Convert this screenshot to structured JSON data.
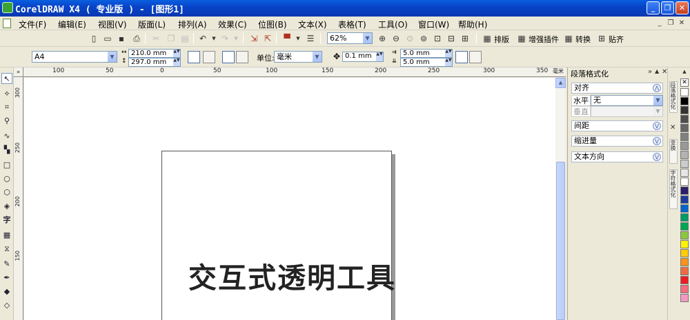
{
  "titlebar": {
    "title": "CorelDRAW X4 ( 专业版 ) - [图形1]",
    "minimize": "_",
    "restore": "❐",
    "close": "✕"
  },
  "menu": {
    "items": [
      "文件(F)",
      "编辑(E)",
      "视图(V)",
      "版面(L)",
      "排列(A)",
      "效果(C)",
      "位图(B)",
      "文本(X)",
      "表格(T)",
      "工具(O)",
      "窗口(W)",
      "帮助(H)"
    ],
    "mdi_minimize": "_",
    "mdi_restore": "❐",
    "mdi_close": "✕"
  },
  "standard_toolbar": {
    "zoom": "62%",
    "text_buttons": [
      "排版",
      "增强插件",
      "转换",
      "贴齐"
    ]
  },
  "property_bar": {
    "paper_size": "A4",
    "width": "210.0 mm",
    "height": "297.0 mm",
    "units_label": "单位:",
    "units_value": "毫米",
    "nudge": "0.1 mm",
    "dup_x": "5.0 mm",
    "dup_y": "5.0 mm"
  },
  "ruler": {
    "h_labels": [
      "100",
      "50",
      "0",
      "50",
      "100",
      "150",
      "200",
      "250",
      "300",
      "350"
    ],
    "h_unit": "毫米",
    "v_labels": [
      "300",
      "250",
      "200",
      "150"
    ]
  },
  "page": {
    "text": "交互式透明工具"
  },
  "docker": {
    "title": "段落格式化",
    "sections": {
      "align": "对齐",
      "spacing": "间距",
      "indent": "缩进量",
      "text_direction": "文本方向"
    },
    "horizontal_label": "水平",
    "horizontal_value": "无",
    "vertical_label": "垂直",
    "vertical_value": ""
  },
  "dock_tabs": [
    "段落格式化",
    "变换",
    "字符格式化"
  ],
  "palette": {
    "colors": [
      "#ffffff",
      "#000000",
      "#333333",
      "#4d4d4d",
      "#666666",
      "#808080",
      "#999999",
      "#b3b3b3",
      "#cccccc",
      "#e6e6e6",
      "#ffffff",
      "#2b1f6b",
      "#1e3c9a",
      "#0066cc",
      "#009a66",
      "#00a651",
      "#8dc63f",
      "#fff200",
      "#ffcc00",
      "#f7941d",
      "#ef6c40",
      "#ed1c24",
      "#f26d7d",
      "#f49ac1"
    ]
  }
}
